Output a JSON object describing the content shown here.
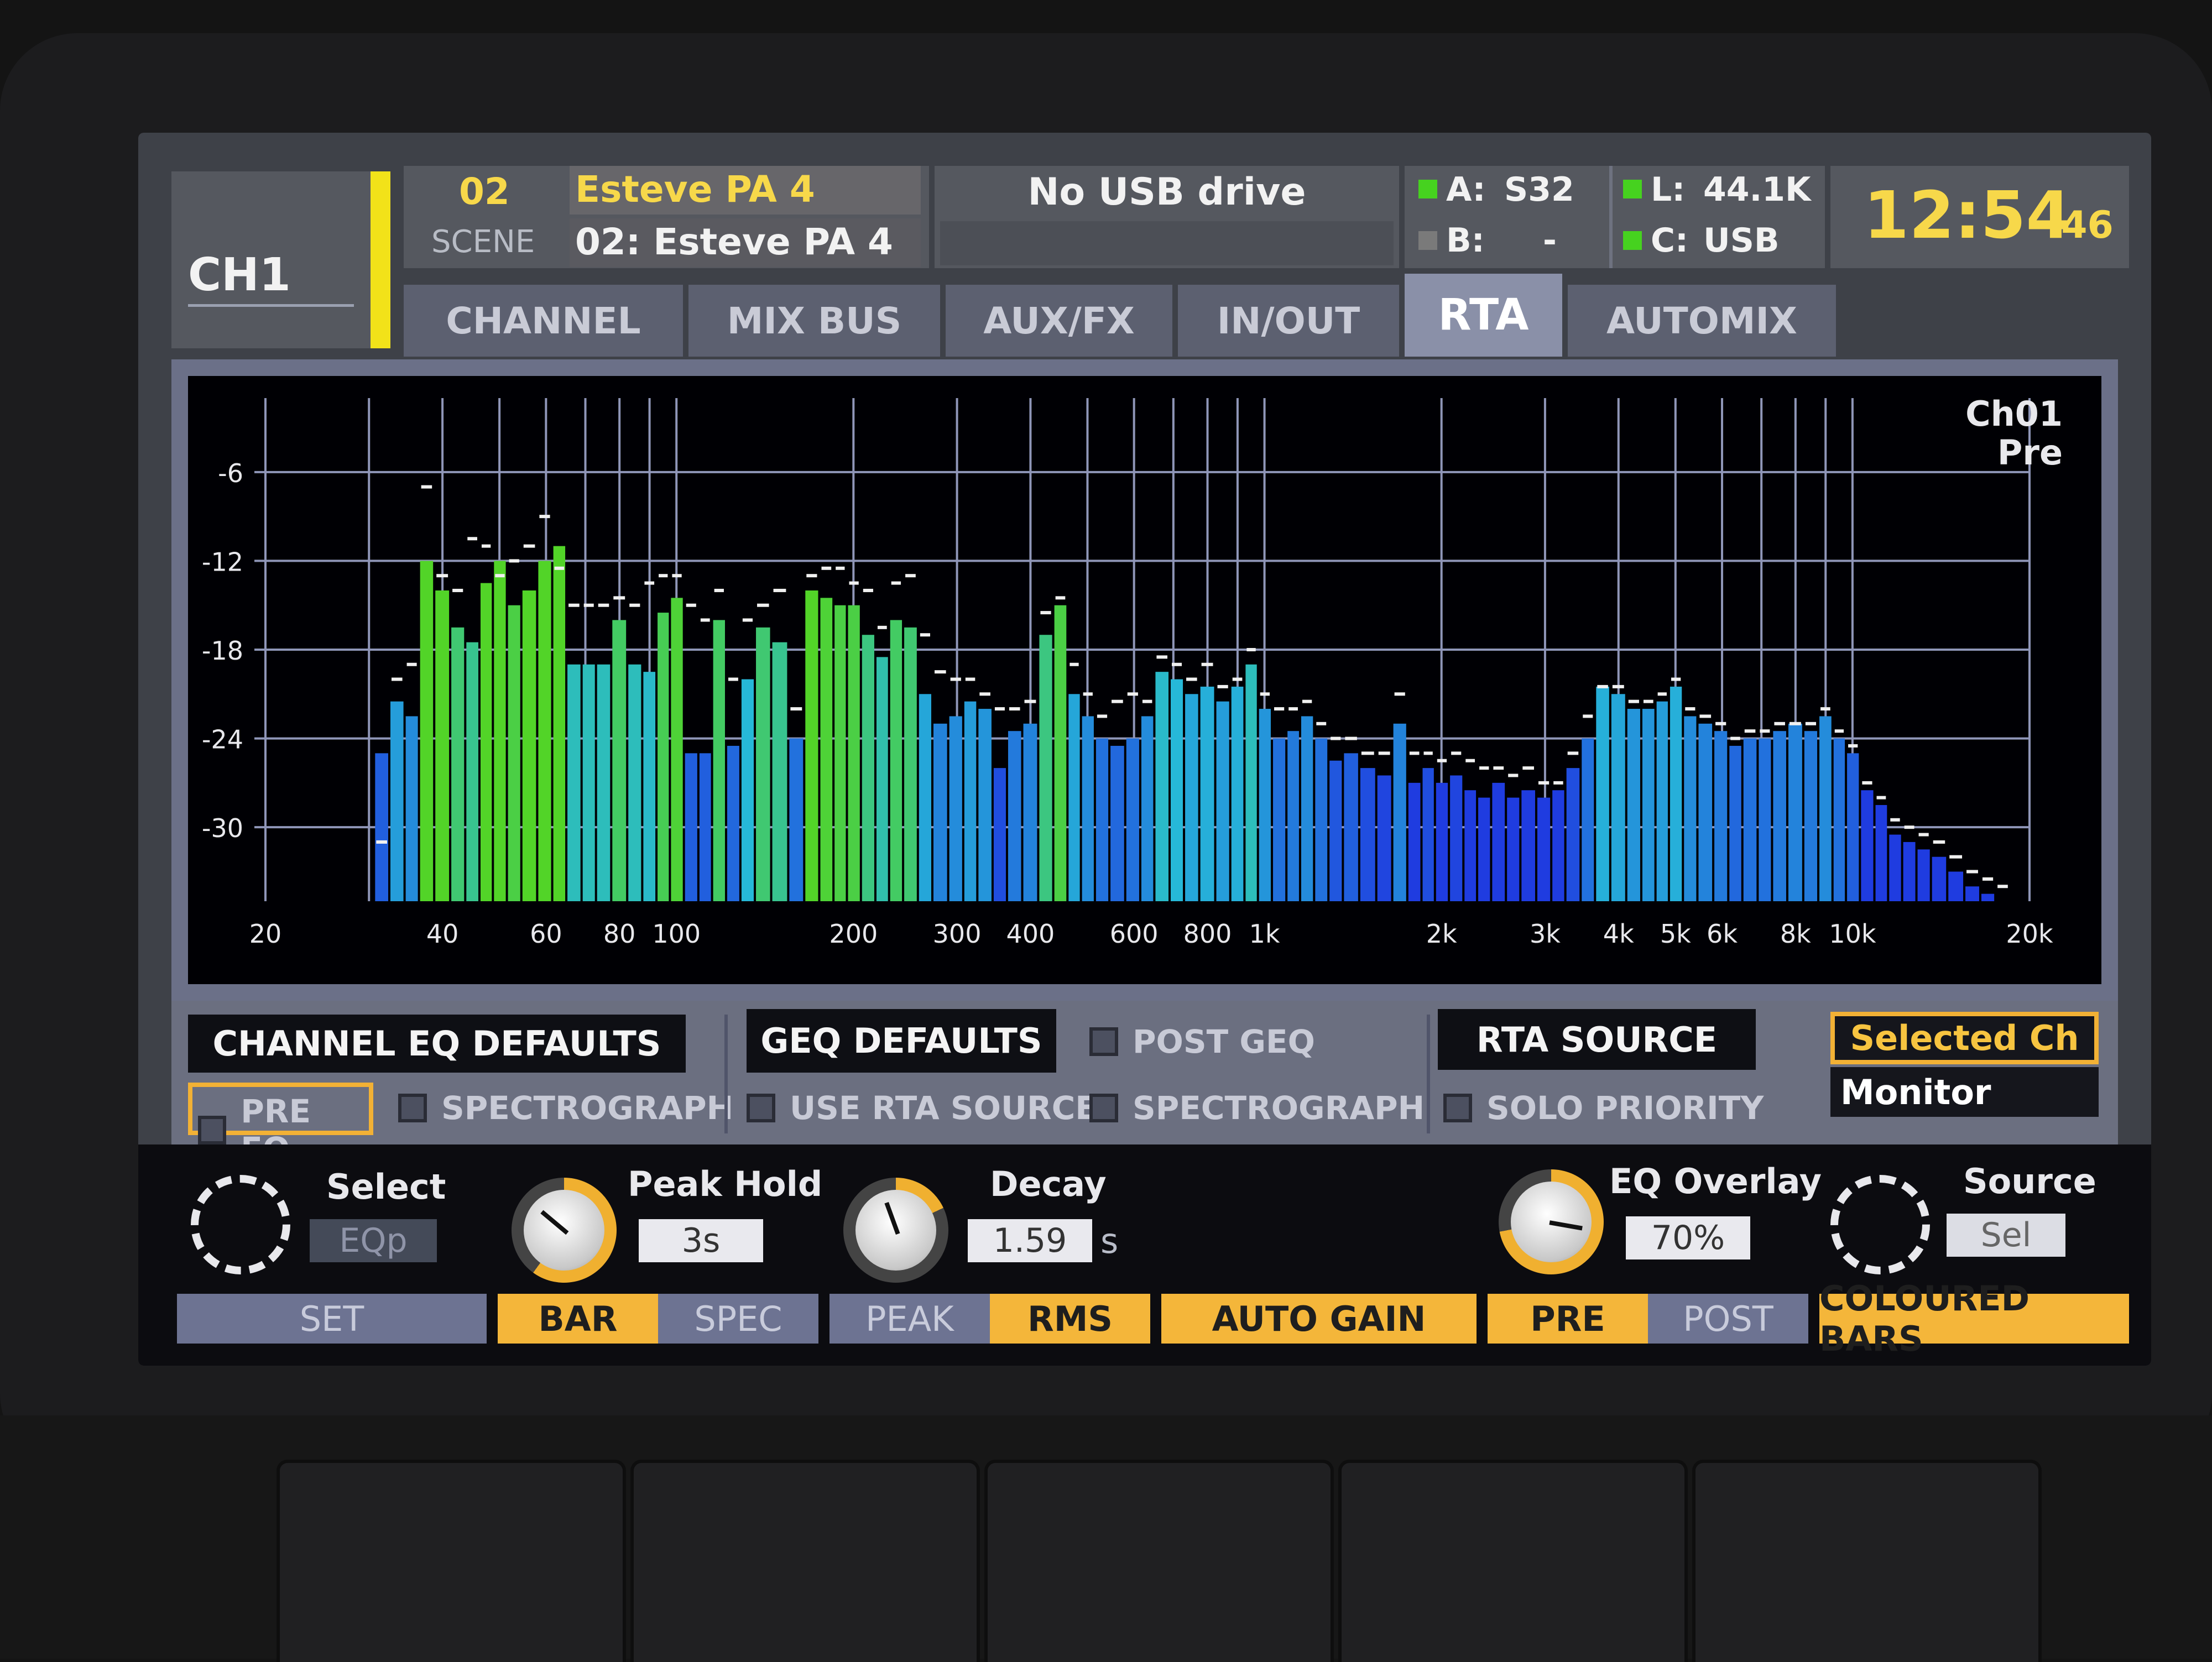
{
  "header": {
    "channel": "CH1",
    "scene_number": "02",
    "scene_label": "SCENE",
    "scene_title": "Esteve PA 4",
    "scene_name": "02: Esteve PA 4",
    "usb_status": "No USB drive",
    "status": {
      "a_label": "A:",
      "a_value": "S32",
      "b_label": "B:",
      "b_value": "-",
      "l_label": "L:",
      "l_value": "44.1K",
      "c_label": "C:",
      "c_value": "USB"
    },
    "clock_hm": "12:54",
    "clock_s": ":46"
  },
  "tabs": [
    "CHANNEL",
    "MIX BUS",
    "AUX/FX",
    "IN/OUT",
    "RTA",
    "AUTOMIX"
  ],
  "active_tab": "RTA",
  "chart_data": {
    "type": "bar",
    "title": "",
    "source_label_1": "Ch01",
    "source_label_2": "Pre",
    "xlabel": "",
    "ylabel": "",
    "x_scale": "log",
    "xlim": [
      20,
      20000
    ],
    "ylim": [
      -35,
      -1
    ],
    "x_ticks": [
      20,
      40,
      60,
      80,
      100,
      200,
      300,
      400,
      600,
      800,
      1000,
      2000,
      3000,
      4000,
      5000,
      6000,
      8000,
      10000,
      20000
    ],
    "x_tick_labels": [
      "20",
      "40",
      "60",
      "80",
      "100",
      "200",
      "300",
      "400",
      "600",
      "800",
      "1k",
      "2k",
      "3k",
      "4k",
      "5k",
      "6k",
      "8k",
      "10k",
      "20k"
    ],
    "y_ticks": [
      -6,
      -12,
      -18,
      -24,
      -30
    ],
    "y_tick_labels": [
      "-6",
      "-12",
      "-18",
      "-24",
      "-30"
    ],
    "grid": true,
    "colors": {
      "low": "#1f3ce0",
      "mid": "#26b8d8",
      "high": "#52d428"
    },
    "frequencies": [
      31.5,
      33.5,
      35.5,
      37.5,
      40,
      42.5,
      45,
      47.5,
      50,
      53,
      56,
      60,
      63,
      67,
      71,
      75,
      80,
      85,
      90,
      95,
      100,
      106,
      112,
      118,
      125,
      132,
      140,
      150,
      160,
      170,
      180,
      190,
      200,
      212,
      224,
      236,
      250,
      265,
      280,
      300,
      315,
      335,
      355,
      375,
      400,
      425,
      450,
      475,
      500,
      530,
      560,
      600,
      630,
      670,
      710,
      750,
      800,
      850,
      900,
      950,
      1000,
      1060,
      1120,
      1180,
      1250,
      1320,
      1400,
      1500,
      1600,
      1700,
      1800,
      1900,
      2000,
      2120,
      2240,
      2360,
      2500,
      2650,
      2800,
      3000,
      3150,
      3350,
      3550,
      3750,
      4000,
      4250,
      4500,
      4750,
      5000,
      5300,
      5600,
      6000,
      6300,
      6700,
      7100,
      7500,
      8000,
      8500,
      9000,
      9500,
      10000,
      10600,
      11200,
      11800,
      12500,
      13200,
      14000,
      15000,
      16000,
      17000,
      18000
    ],
    "values": [
      -25,
      -21.5,
      -22.5,
      -12,
      -14,
      -16.5,
      -17.5,
      -13.5,
      -12,
      -15,
      -14,
      -12,
      -11,
      -19,
      -19,
      -19,
      -16,
      -19,
      -19.5,
      -15.5,
      -14.5,
      -25,
      -25,
      -16,
      -24.5,
      -20,
      -16.5,
      -17.5,
      -24,
      -14,
      -14.5,
      -15,
      -15,
      -17,
      -18.5,
      -16,
      -16.5,
      -21,
      -23,
      -22.5,
      -21.5,
      -22,
      -26,
      -23.5,
      -23,
      -17,
      -15,
      -21,
      -22.5,
      -24,
      -24.5,
      -24,
      -22.5,
      -19.5,
      -20,
      -21,
      -20.5,
      -21.5,
      -20.5,
      -19,
      -22,
      -24,
      -23.5,
      -22.5,
      -24,
      -25.5,
      -25,
      -26,
      -26.5,
      -23,
      -27,
      -26,
      -27,
      -26.5,
      -27.5,
      -28,
      -27,
      -28,
      -27.5,
      -28,
      -27.5,
      -26,
      -24,
      -20.5,
      -21,
      -22,
      -22,
      -21.5,
      -20.5,
      -22.5,
      -23,
      -23.5,
      -24.5,
      -24,
      -24,
      -23.5,
      -23,
      -23.5,
      -22.5,
      -24,
      -25,
      -27.5,
      -28.5,
      -30.5,
      -31,
      -31.5,
      -32,
      -33,
      -34,
      -34.5,
      -35
    ],
    "peaks": [
      -31,
      -20,
      -19,
      -7,
      -13,
      -14,
      -10.5,
      -11,
      -13,
      -12,
      -11,
      -9,
      -12.5,
      -15,
      -15,
      -15,
      -14.5,
      -15,
      -13.5,
      -13,
      -13,
      -15,
      -16,
      -14,
      -20,
      -16,
      -15,
      -14,
      -22,
      -13,
      -12.5,
      -12.5,
      -13.5,
      -14,
      -16.5,
      -13.5,
      -13,
      -17,
      -19.5,
      -20,
      -20,
      -21,
      -22,
      -22,
      -21.5,
      -15.5,
      -14.5,
      -19,
      -21,
      -22.5,
      -21.5,
      -21,
      -21.5,
      -18.5,
      -19,
      -20,
      -19,
      -20.5,
      -20,
      -18,
      -21,
      -22,
      -22,
      -21.5,
      -23,
      -24,
      -24,
      -25,
      -25,
      -21,
      -25,
      -25,
      -25.5,
      -25,
      -25.5,
      -26,
      -26,
      -26.5,
      -26,
      -27,
      -27,
      -25,
      -22.5,
      -20.5,
      -20.5,
      -21.5,
      -21.5,
      -21,
      -20,
      -22,
      -22.5,
      -23,
      -24,
      -23.5,
      -23.5,
      -23,
      -23,
      -23,
      -22,
      -23.5,
      -24.5,
      -27,
      -28,
      -29.5,
      -30,
      -30.5,
      -31,
      -32,
      -33,
      -33.5,
      -34
    ]
  },
  "controls_band": {
    "channel_eq_defaults": "CHANNEL EQ DEFAULTS",
    "pre_eq": "PRE EQ",
    "spectrograph_1": "SPECTROGRAPH",
    "geq_defaults": "GEQ DEFAULTS",
    "post_geq": "POST GEQ",
    "use_rta_source": "USE RTA SOURCE",
    "spectrograph_2": "SPECTROGRAPH",
    "rta_source": "RTA SOURCE",
    "solo_priority": "SOLO PRIORITY",
    "selected_ch": "Selected Ch",
    "monitor": "Monitor"
  },
  "rotaries": {
    "select_label": "Select",
    "select_value": "EQp",
    "peak_hold_label": "Peak Hold",
    "peak_hold_value": "3s",
    "decay_label": "Decay",
    "decay_value": "1.59",
    "decay_unit": "s",
    "eq_overlay_label": "EQ Overlay",
    "eq_overlay_value": "70%",
    "source_label": "Source",
    "source_value": "Sel"
  },
  "function_buttons": {
    "set": "SET",
    "bar": "BAR",
    "spec": "SPEC",
    "peak": "PEAK",
    "rms": "RMS",
    "auto_gain": "AUTO GAIN",
    "pre": "PRE",
    "post": "POST",
    "coloured_bars": "COLOURED BARS"
  }
}
